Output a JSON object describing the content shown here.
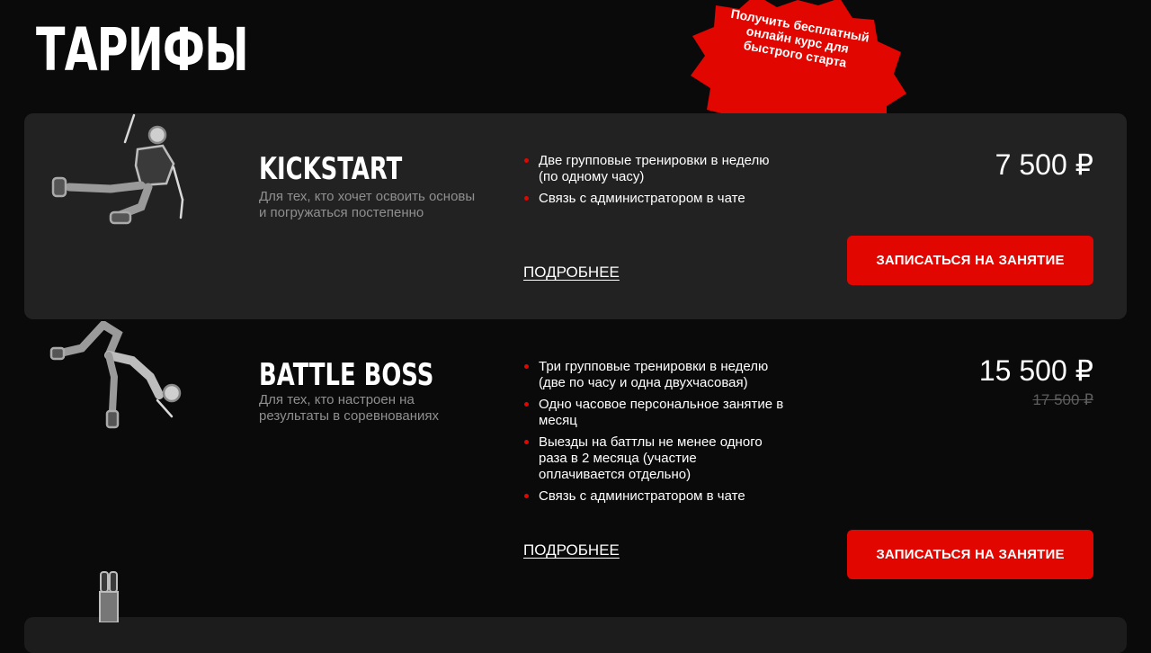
{
  "page": {
    "title": "ТАРИФЫ"
  },
  "promo": {
    "text": "Получить бесплатный онлайн курс для быстрого старта",
    "color": "#e10600"
  },
  "plans": [
    {
      "name": "KICKSTART",
      "description": "Для тех, кто хочет освоить основы и погружаться постепенно",
      "features": [
        "Две групповые тренировки в неделю (по одному часу)",
        "Связь с администратором в чате"
      ],
      "more_link": "ПОДРОБНЕЕ",
      "price": "7 500 ₽",
      "cta": "ЗАПИСАТЬСЯ НА ЗАНЯТИЕ",
      "illustration": "breakdancer-freeze-illustration"
    },
    {
      "name": "BATTLE BOSS",
      "description": "Для тех, кто настроен на результаты в соревнованиях",
      "features": [
        "Три групповые тренировки в неделю (две по часу и одна двухчасовая)",
        "Одно часовое персональное занятие в месяц",
        "Выезды на баттлы не менее одного раза в 2 месяца (участие оплачивается отдельно)",
        "Связь с администратором в чате"
      ],
      "more_link": "ПОДРОБНЕЕ",
      "price": "15 500 ₽",
      "old_price": "17 500 ₽",
      "cta": "ЗАПИСАТЬСЯ НА ЗАНЯТИЕ",
      "illustration": "breakdancer-bridge-illustration"
    }
  ],
  "colors": {
    "accent": "#e10600",
    "background": "#0a0a0a",
    "card": "#222222",
    "muted_text": "#8f8f8f"
  }
}
